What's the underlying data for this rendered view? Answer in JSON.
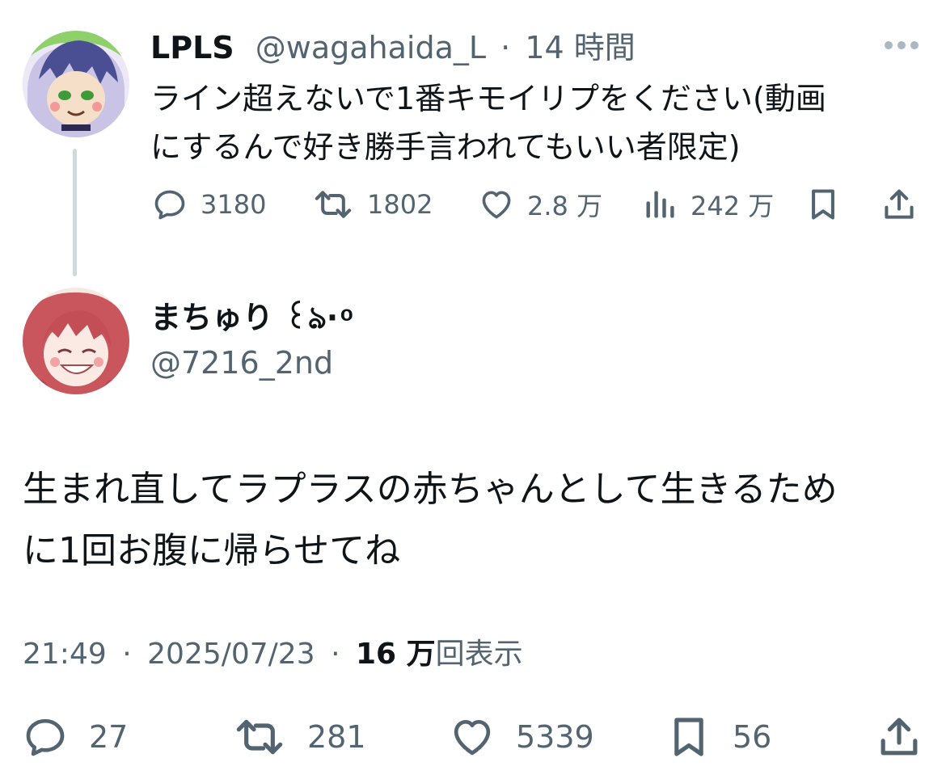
{
  "parent_tweet": {
    "author_name": "LPLS",
    "author_handle": "@wagahaida_L",
    "separator": "·",
    "time_ago": "14 時間",
    "text_line1": "ライン超えないで1番キモイリプをください(動画",
    "text_line2": "にするんで好き勝手言われてもいい者限定)",
    "replies": "3180",
    "reposts": "1802",
    "likes": "2.8 万",
    "views": "242 万"
  },
  "reply_tweet": {
    "author_name": "まちゅり ꒰ঌ· ͦ",
    "author_handle": "@7216_2nd",
    "text_line1": "生まれ直してラプラスの赤ちゃんとして生きるため",
    "text_line2": "に1回お腹に帰らせてね",
    "time": "21:49",
    "date": "2025/07/23",
    "separator": "·",
    "views_count": "16 万",
    "views_label": "回表示",
    "replies": "27",
    "reposts": "281",
    "likes": "5339",
    "bookmarks": "56"
  },
  "icons": {
    "reply": "speech-bubble-icon",
    "repost": "repost-arrows-icon",
    "like": "heart-icon",
    "views": "bar-chart-icon",
    "bookmark": "bookmark-icon",
    "share": "share-upload-icon",
    "more": "more-dots-icon"
  },
  "colors": {
    "text_primary": "#0f1419",
    "text_secondary": "#536471",
    "thread_line": "#cfd9de"
  }
}
